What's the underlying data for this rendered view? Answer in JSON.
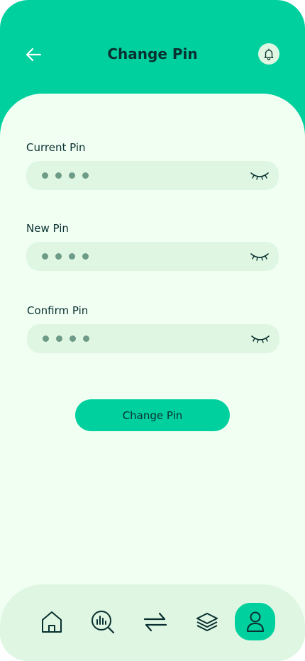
{
  "header": {
    "title": "Change Pin",
    "back_icon": "arrow-left-icon",
    "notification_icon": "bell-icon"
  },
  "form": {
    "fields": [
      {
        "label": "Current Pin",
        "masked_value": "••••",
        "toggle_icon": "eye-closed-icon"
      },
      {
        "label": "New Pin",
        "masked_value": "••••",
        "toggle_icon": "eye-closed-icon"
      },
      {
        "label": "Confirm Pin",
        "masked_value": "••••",
        "toggle_icon": "eye-closed-icon"
      }
    ],
    "submit_label": "Change Pin"
  },
  "nav": {
    "items": [
      {
        "icon": "home-icon",
        "active": false
      },
      {
        "icon": "analysis-icon",
        "active": false
      },
      {
        "icon": "transfer-icon",
        "active": false
      },
      {
        "icon": "layers-icon",
        "active": false
      },
      {
        "icon": "profile-icon",
        "active": true
      }
    ]
  },
  "colors": {
    "brand": "#00D09E",
    "background": "#F1FFF3",
    "field": "#DFF7E2",
    "text": "#093030"
  }
}
